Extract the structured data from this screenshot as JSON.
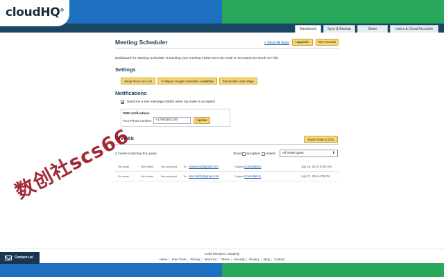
{
  "header": {
    "logo": "cloudHQ",
    "tabs": [
      {
        "label": "Dashboard",
        "active": true
      },
      {
        "label": "Sync & Backup",
        "active": false
      },
      {
        "label": "Share",
        "active": false
      },
      {
        "label": "Users & Cloud Accounts",
        "active": false
      }
    ]
  },
  "page": {
    "title": "Meeting Scheduler",
    "show_all_apps": "« Show All Apps",
    "upgrade_label": "Upgrade!",
    "my_account_label": "My Account",
    "description": "Dashboard for Meeting Scheduler is tracking your meeting invites sent via email or accessed via 'Book me' link."
  },
  "settings": {
    "title": "Settings",
    "buttons": [
      "Setup 'Book me' Link",
      "Configure Google Calendars Availability",
      "Personalize Invite Page"
    ]
  },
  "notifications": {
    "title": "Notifications",
    "sms_checkbox_label": "Send me a text message (SMS) when my invite is accepted",
    "sms_checked": true,
    "sms_box_title": "SMS notifications",
    "phone_label": "Your Phone number:",
    "phone_value": "+17863181230",
    "update_label": "Update"
  },
  "invites": {
    "title": "Invites",
    "export_label": "Export Data to CSV",
    "matching_text": "2 invites matching the query.",
    "show_label": "Show:",
    "filter_accepted": "accepted",
    "filter_visited": "visited",
    "type_select": "All invite types",
    "rows": [
      {
        "via": "Via email",
        "visited": "Not visited",
        "accepted": "Not accepted",
        "to_label": "To:",
        "email": "newclient@gmail.com",
        "subject_label": "Subject:",
        "subject": "Consultation",
        "date": "July 16, 2019 10:05 AM"
      },
      {
        "via": "Via email",
        "visited": "Not visited",
        "accepted": "Not accepted",
        "to_label": "To:",
        "email": "dan.smith@gmail.com",
        "subject_label": "Subject:",
        "subject": "Consultation",
        "date": "July 17, 2019 4:05 PM"
      }
    ]
  },
  "footer": {
    "invite_friends": "Invite friends to cloudHQ",
    "links": [
      "Home",
      "Free Tools",
      "Pricing",
      "About Us",
      "Terms",
      "Security",
      "Privacy",
      "Blog",
      "Contact"
    ],
    "contact_us": "Contact us!"
  },
  "watermark": "数创社scs66",
  "colors": {
    "header_blue": "#1d6fbf",
    "header_green": "#27a85a",
    "header_bar": "#1a4663",
    "button_yellow": "#f7d675",
    "link_blue": "#1a5fa8",
    "watermark_red": "#9a1824"
  }
}
